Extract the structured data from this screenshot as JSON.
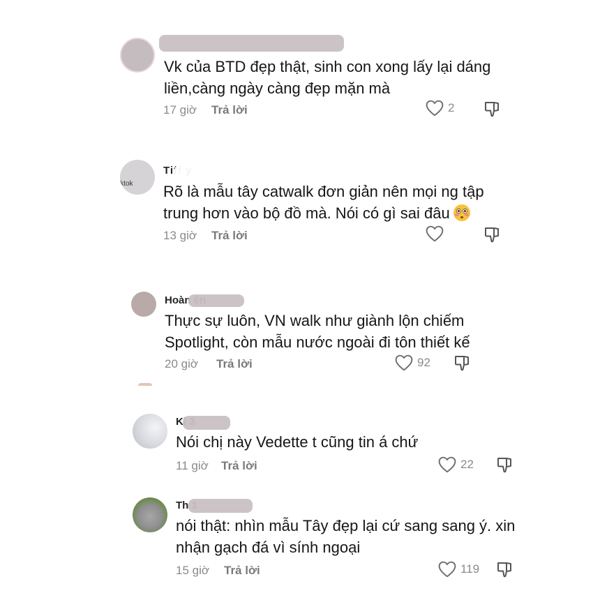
{
  "comments": [
    {
      "username": "",
      "text_line1": "Vk của BTD đẹp thật, sinh con xong lấy lại dáng",
      "text_line2": "liền,càng ngày càng đẹp mặn mà",
      "time": "17 giờ",
      "reply": "Trả lời",
      "likes": "2"
    },
    {
      "username": "Tiff y",
      "avatar_text": "iktok",
      "text_line1": "Rõ là mẫu tây catwalk đơn giản nên mọi ng tập",
      "text_line2": "trung hơn vào bộ đồ mà. Nói có gì sai đâu",
      "emoji": "flushed-face-emoji",
      "time": "13 giờ",
      "reply": "Trả lời",
      "likes": ""
    },
    {
      "username": "Hoàn ên",
      "text_line1": "Thực sự luôn, VN walk như giành lộn chiếm",
      "text_line2": "Spotlight, còn mẫu nước ngoài đi tôn thiết kế",
      "time": "20 giờ",
      "reply": "Trả lời",
      "likes": "92"
    },
    {
      "username": "Ki 3",
      "text_line1": "Nói chị này Vedette t cũng tin á chứ",
      "time": "11 giờ",
      "reply": "Trả lời",
      "likes": "22"
    },
    {
      "username": "Th 1",
      "text_line1": "nói thật: nhìn mẫu Tây đẹp lại cứ sang sang ý. xin",
      "text_line2": "nhận gạch đá vì sính ngoại",
      "time": "15 giờ",
      "reply": "Trả lời",
      "likes": "119"
    }
  ],
  "icons": {
    "like": "heart-outline-icon",
    "dislike": "thumbs-down-icon"
  },
  "colors": {
    "meta_gray": "#8a8a8a",
    "redaction": "#c9c0c3"
  }
}
